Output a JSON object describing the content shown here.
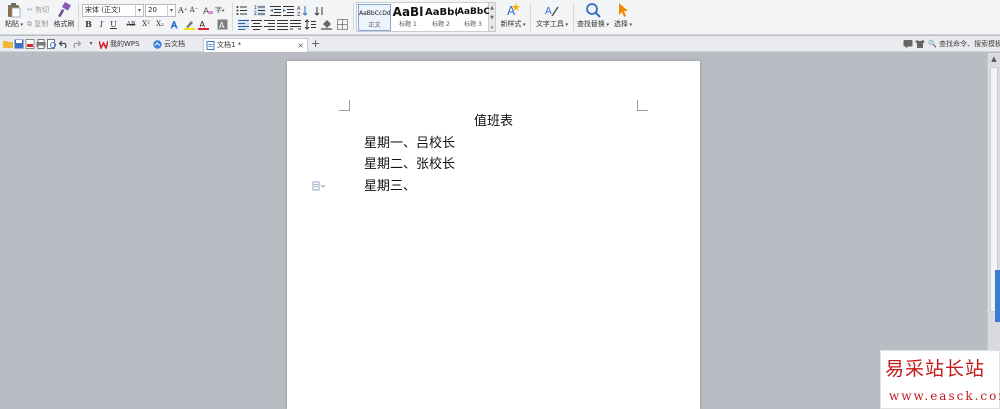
{
  "ribbon": {
    "clipboard": {
      "paste_label": "粘贴",
      "cut_label": "剪切",
      "copy_label": "复制",
      "format_painter_label": "格式刷"
    },
    "font": {
      "font_name": "宋体 (正文)",
      "font_size": "20",
      "bold": "B",
      "italic": "I",
      "underline": "U",
      "strikethrough": "AB",
      "superscript": "X²",
      "subscript": "X₂",
      "grow": "A⁺",
      "shrink": "A⁻"
    },
    "styles": [
      {
        "preview": "AaBbCcDd",
        "label": "正文"
      },
      {
        "preview": "AaBl",
        "label": "标题 1"
      },
      {
        "preview": "AaBb(",
        "label": "标题 2"
      },
      {
        "preview": "AaBbC",
        "label": "标题 3"
      }
    ],
    "new_style_label": "新样式",
    "text_tools_label": "文字工具",
    "find_replace_label": "查找替换",
    "select_label": "选择"
  },
  "tabs": [
    {
      "label": "我的WPS"
    },
    {
      "label": "云文档"
    },
    {
      "label": "文档1 *"
    }
  ],
  "search": {
    "label": "查找命令、搜索模板"
  },
  "document": {
    "title": "值班表",
    "lines": [
      "星期一、吕校长",
      "星期二、张校长",
      "星期三、"
    ]
  },
  "watermark": {
    "cn": "易采站长站",
    "url": "www.easck.com"
  },
  "colors": {
    "accent": "#3c7bd0",
    "wps_red": "#d9232d",
    "watermark_red": "#c31b1b",
    "page_bg": "#ffffff",
    "workspace_bg": "#b9bcc3"
  }
}
